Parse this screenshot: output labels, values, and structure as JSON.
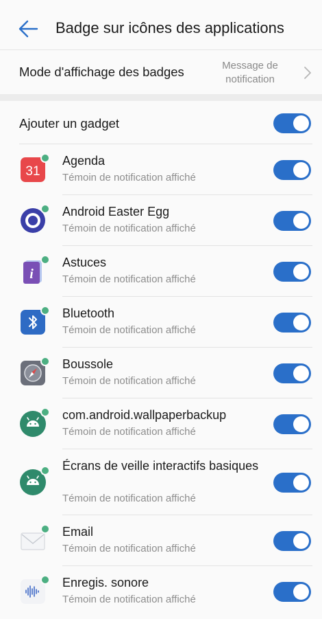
{
  "header": {
    "title": "Badge sur icônes des applications"
  },
  "badge_mode": {
    "label": "Mode d'affichage des badges",
    "value_line1": "Message de",
    "value_line2": "notification"
  },
  "gadget": {
    "label": "Ajouter un gadget",
    "enabled": true
  },
  "apps": [
    {
      "name": "Agenda",
      "status": "Témoin de notification affiché",
      "icon": "calendar-icon",
      "enabled": true,
      "calendar_day": "31"
    },
    {
      "name": "Android Easter Egg",
      "status": "Témoin de notification affiché",
      "icon": "easter-egg-icon",
      "enabled": true
    },
    {
      "name": "Astuces",
      "status": "Témoin de notification affiché",
      "icon": "tips-icon",
      "enabled": true,
      "glyph": "i"
    },
    {
      "name": "Bluetooth",
      "status": "Témoin de notification affiché",
      "icon": "bluetooth-icon",
      "enabled": true
    },
    {
      "name": "Boussole",
      "status": "Témoin de notification affiché",
      "icon": "compass-icon",
      "enabled": true
    },
    {
      "name": "com.android.wallpaperbackup",
      "status": "Témoin de notification affiché",
      "icon": "android-icon",
      "enabled": true
    },
    {
      "name": "Écrans de veille interactifs basiques",
      "status": "Témoin de notification affiché",
      "icon": "android-icon",
      "enabled": true
    },
    {
      "name": "Email",
      "status": "Témoin de notification affiché",
      "icon": "email-icon",
      "enabled": true
    },
    {
      "name": "Enregis. sonore",
      "status": "Témoin de notification affiché",
      "icon": "sound-recorder-icon",
      "enabled": true
    }
  ],
  "colors": {
    "toggle_on": "#2a6fc9",
    "badge_dot": "#4caf82"
  }
}
